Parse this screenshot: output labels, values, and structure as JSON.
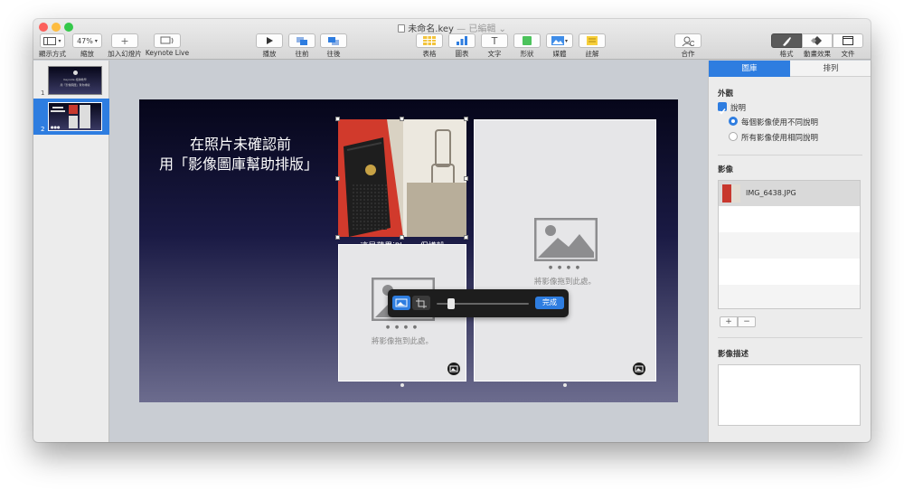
{
  "window": {
    "title": "未命名.key",
    "title_status": "— 已編輯",
    "status_chevron": "⌄"
  },
  "toolbar": {
    "view_label": "顯示方式",
    "zoom_value": "47%",
    "zoom_label": "縮放",
    "add_slide_symbol": "+",
    "add_slide_label": "加入幻燈片",
    "keynote_live_label": "Keynote Live",
    "play_label": "播放",
    "forward_label": "往前",
    "backward_label": "往後",
    "table_label": "表格",
    "chart_label": "圖表",
    "text_label": "文字",
    "text_symbol": "T",
    "shape_label": "形狀",
    "media_label": "媒體",
    "comment_label": "註解",
    "collaborate_label": "合作",
    "format_label": "格式",
    "animate_label": "動畫效果",
    "document_label": "文件"
  },
  "navigator": {
    "slides": [
      {
        "number": "1",
        "line1": "Keynote 相簿教學",
        "line2": "用「影像圖庫」幫你排版"
      },
      {
        "number": "2",
        "dots": "●●●"
      }
    ]
  },
  "slide": {
    "text_line1": "在照片未確認前",
    "text_line2": "用「影像圖庫幫助排版」",
    "placeholder_text": "將影像拖到此處。",
    "dots": "● ● ● ●",
    "hidden_caption": "這是蘋果iPhone保護殼"
  },
  "hud": {
    "done_label": "完成",
    "slider_value": 0.12
  },
  "inspector": {
    "tab_gallery": "圖庫",
    "tab_arrange": "排列",
    "appearance_title": "外觀",
    "caption_checkbox": "說明",
    "caption_checked": true,
    "radio_different": "每個影像使用不同說明",
    "radio_same": "所有影像使用相同說明",
    "images_title": "影像",
    "images": [
      "IMG_6438.JPG"
    ],
    "add_symbol": "+",
    "remove_symbol": "−",
    "description_title": "影像描述"
  },
  "colors": {
    "accent": "#2e7de0",
    "close": "#fc605c",
    "minimize": "#fdbc40",
    "zoom": "#34c84a"
  }
}
